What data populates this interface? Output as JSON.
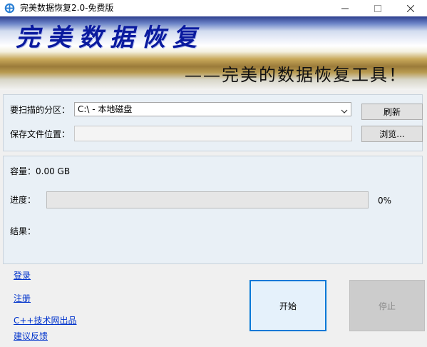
{
  "window": {
    "title": "完美数据恢复2.0-免费版",
    "controls": [
      "minimize-icon",
      "maximize-icon",
      "close-icon"
    ]
  },
  "banner": {
    "title": "完美数据恢复",
    "slogan": "——完美的数据恢复工具！"
  },
  "form": {
    "partition_label": "要扫描的分区：",
    "partition_value": "C:\\  -  本地磁盘",
    "save_label": "保存文件位置：",
    "save_value": "",
    "refresh_label": "刷新",
    "browse_label": "浏览..."
  },
  "status": {
    "capacity_label": "容量：",
    "capacity_value": "0.00 GB",
    "progress_label": "进度：",
    "progress_percent": "0%",
    "progress_value": 0,
    "result_label": "结果："
  },
  "links": [
    "登录",
    "注册",
    "C++技术网出品",
    "建议反馈"
  ],
  "actions": {
    "start_label": "开始",
    "stop_label": "停止"
  },
  "colors": {
    "accent": "#0078d7",
    "link": "#0033cc",
    "banner_title": "#0a1a9e",
    "panel_bg": "#e9f0f6"
  }
}
